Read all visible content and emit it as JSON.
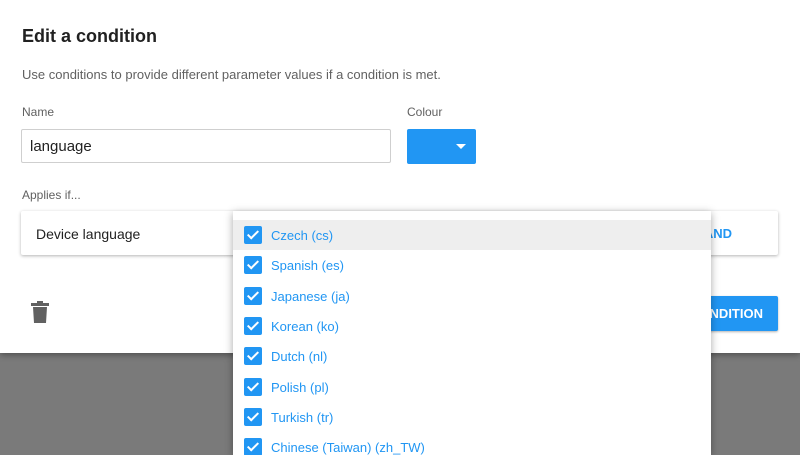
{
  "dialog": {
    "title": "Edit a condition",
    "subtitle": "Use conditions to provide different parameter values if a condition is met.",
    "name_label": "Name",
    "name_value": "language",
    "colour_label": "Colour",
    "colour_value": "#2196f3",
    "applies_label": "Applies if...",
    "rule": {
      "attribute": "Device language",
      "and_label": "AND"
    },
    "create_label": "CREATE CONDITION"
  },
  "dropdown": {
    "items": [
      {
        "label": "Czech (cs)",
        "checked": true
      },
      {
        "label": "Spanish (es)",
        "checked": true
      },
      {
        "label": "Japanese (ja)",
        "checked": true
      },
      {
        "label": "Korean (ko)",
        "checked": true
      },
      {
        "label": "Dutch (nl)",
        "checked": true
      },
      {
        "label": "Polish (pl)",
        "checked": true
      },
      {
        "label": "Turkish (tr)",
        "checked": true
      },
      {
        "label": "Chinese (Taiwan) (zh_TW)",
        "checked": true
      }
    ]
  },
  "colors": {
    "accent": "#2196f3",
    "overlay": "#7a7a7a"
  },
  "icons": {
    "delete": "trash-icon",
    "colour_caret": "caret-down-icon",
    "check": "check-icon"
  }
}
